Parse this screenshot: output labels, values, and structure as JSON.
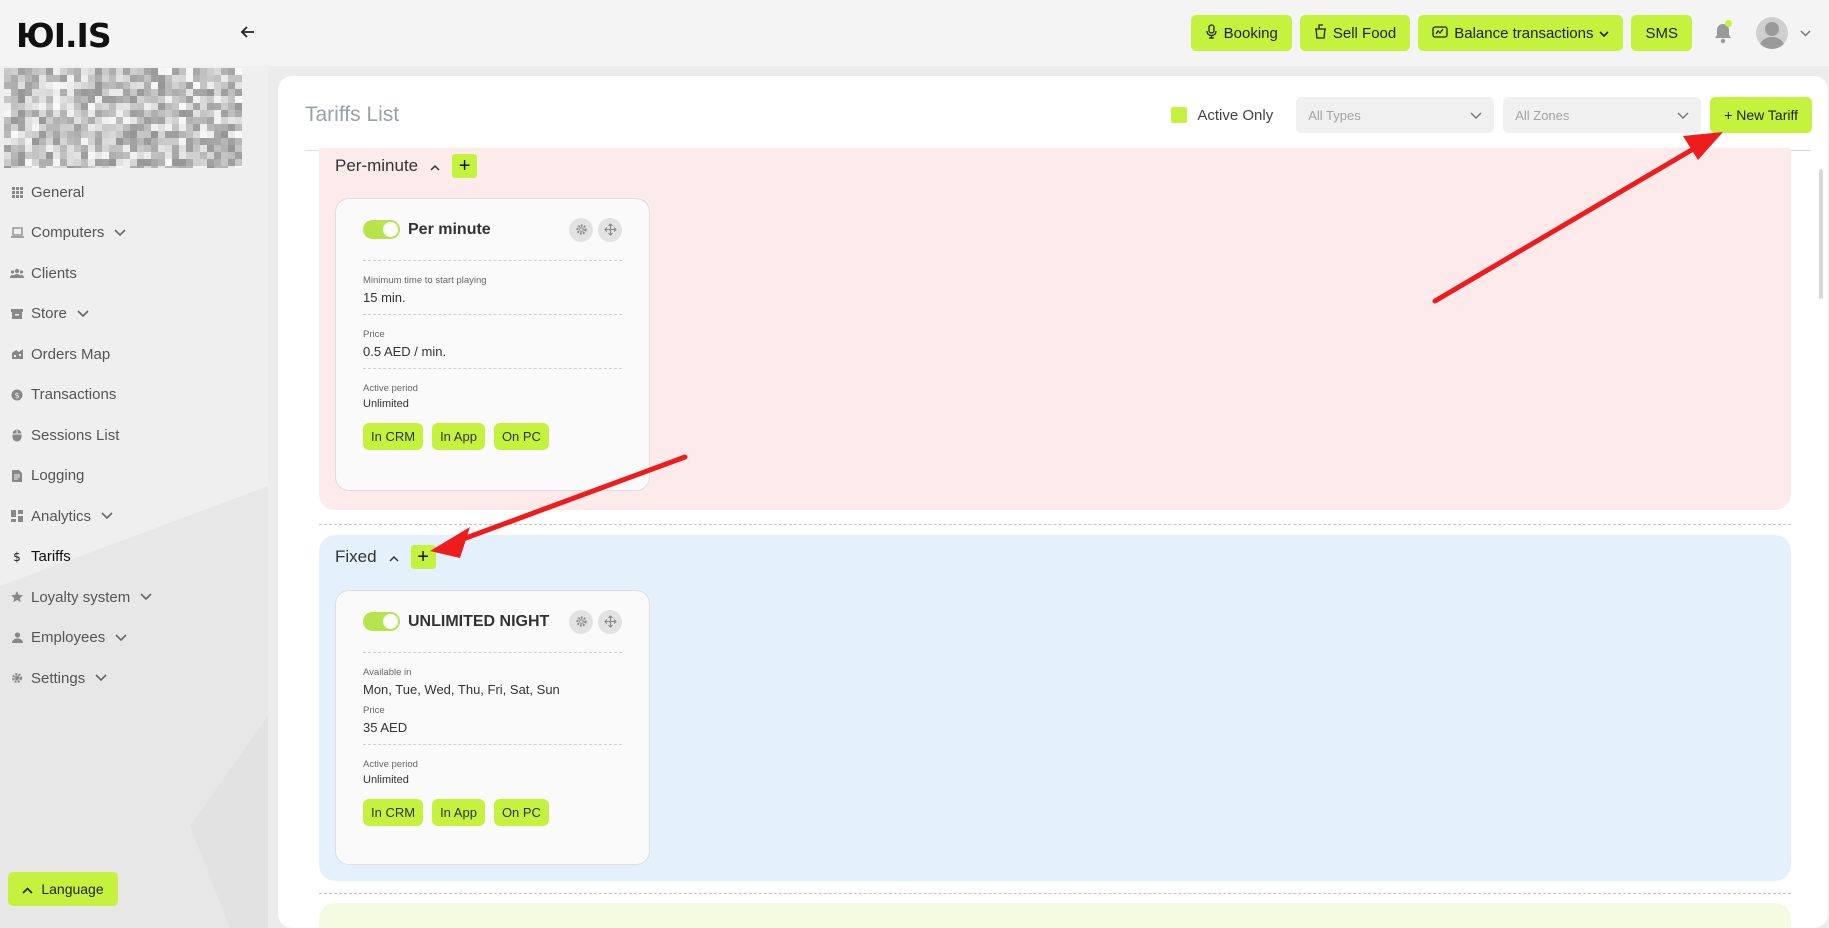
{
  "app": {
    "logo": "ЮI.IS"
  },
  "topbar": {
    "buttons": [
      {
        "label": "Booking",
        "icon": "microphone-icon"
      },
      {
        "label": "Sell Food",
        "icon": "cup-icon"
      },
      {
        "label": "Balance transactions",
        "icon": "wallet-icon"
      },
      {
        "label": "SMS"
      }
    ],
    "accent": "#c5f33d"
  },
  "sidebar": {
    "items": [
      {
        "label": "General",
        "icon": "grid-icon"
      },
      {
        "label": "Computers",
        "icon": "laptop-icon",
        "expandable": true
      },
      {
        "label": "Clients",
        "icon": "users-icon"
      },
      {
        "label": "Store",
        "icon": "store-icon",
        "expandable": true
      },
      {
        "label": "Orders Map",
        "icon": "map-icon"
      },
      {
        "label": "Transactions",
        "icon": "coin-icon"
      },
      {
        "label": "Sessions List",
        "icon": "mouse-icon"
      },
      {
        "label": "Logging",
        "icon": "file-icon"
      },
      {
        "label": "Analytics",
        "icon": "dashboard-icon",
        "expandable": true
      },
      {
        "label": "Tariffs",
        "icon": "dollar-icon",
        "active": true
      },
      {
        "label": "Loyalty system",
        "icon": "star-icon",
        "expandable": true
      },
      {
        "label": "Employees",
        "icon": "user-icon",
        "expandable": true
      },
      {
        "label": "Settings",
        "icon": "gear-icon",
        "expandable": true
      }
    ],
    "language_label": "Language"
  },
  "main": {
    "title": "Tariffs List",
    "filters": {
      "active_only_label": "Active Only",
      "types_placeholder": "All Types",
      "zones_placeholder": "All Zones",
      "new_tariff_label": "+ New Tariff"
    },
    "groups": [
      {
        "name": "Per-minute",
        "color": "#fdeaea",
        "card": {
          "name": "Per minute",
          "fields": [
            {
              "label": "Minimum time to start playing",
              "value": "15 min."
            },
            {
              "label": "Price",
              "value": "0.5 AED / min."
            },
            {
              "label": "Active period",
              "value": "Unlimited"
            }
          ],
          "tags": [
            "In CRM",
            "In App",
            "On PC"
          ]
        }
      },
      {
        "name": "Fixed",
        "color": "#e4f1fc",
        "card": {
          "name": "UNLIMITED NIGHT",
          "fields": [
            {
              "label": "Available in",
              "value": "Mon, Tue, Wed, Thu, Fri, Sat, Sun"
            },
            {
              "label": "Price",
              "value": "35 AED"
            },
            {
              "label": "Active period",
              "value": "Unlimited"
            }
          ],
          "tags": [
            "In CRM",
            "In App",
            "On PC"
          ]
        }
      }
    ]
  }
}
